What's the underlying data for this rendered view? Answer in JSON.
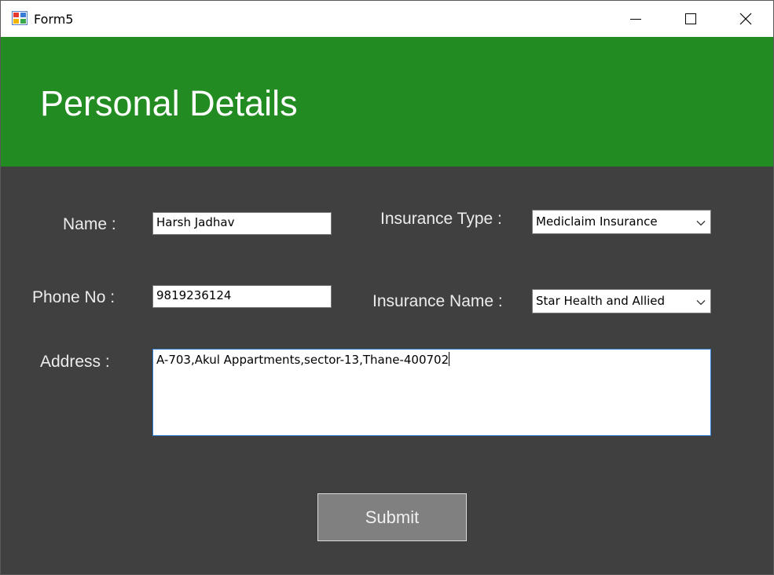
{
  "window": {
    "title": "Form5"
  },
  "header": {
    "title": "Personal Details",
    "color": "#228b22"
  },
  "form": {
    "name_label": "Name :",
    "name_value": "Harsh Jadhav",
    "phone_label": "Phone No :",
    "phone_value": "9819236124",
    "address_label": "Address :",
    "address_value": "A-703,Akul Appartments,sector-13,Thane-400702",
    "insurance_type_label": "Insurance Type :",
    "insurance_type_value": "Mediclaim Insurance",
    "insurance_name_label": "Insurance Name :",
    "insurance_name_value": "Star Health and Allied",
    "submit_label": "Submit"
  },
  "colors": {
    "background": "#404040",
    "button": "#808080"
  }
}
